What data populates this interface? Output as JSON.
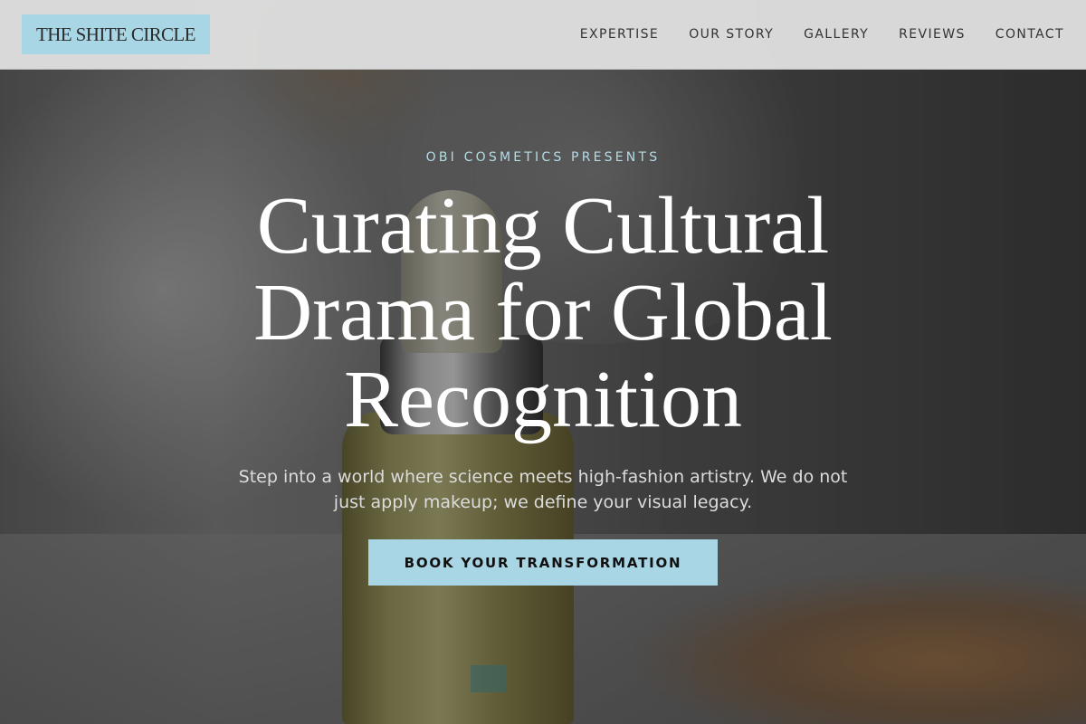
{
  "header": {
    "logo": "THE SHITE CIRCLE",
    "nav": [
      "EXPERTISE",
      "OUR STORY",
      "GALLERY",
      "REVIEWS",
      "CONTACT"
    ]
  },
  "hero": {
    "eyebrow": "OBI COSMETICS PRESENTS",
    "headline": "Curating Cultural Drama for Global Recognition",
    "subtext": "Step into a world where science meets high-fashion artistry. We do not just apply makeup; we define your visual legacy.",
    "cta": "BOOK YOUR TRANSFORMATION"
  },
  "colors": {
    "accent": "#a9d6e5",
    "eyebrow": "#b4dbe6",
    "header_bg": "#dedede"
  }
}
